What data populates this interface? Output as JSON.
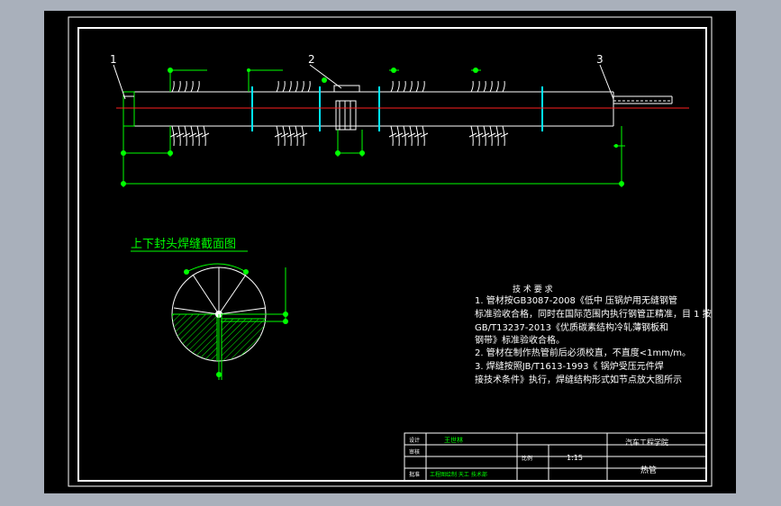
{
  "callouts": {
    "c1": "1",
    "c2": "2",
    "c3": "3"
  },
  "section_title": "上下封头焊缝截面图",
  "tech_req": {
    "title": "技 术 要 求",
    "lines": [
      "1. 管材按GB3087-2008《低中 压锅炉用无缝钢管",
      "标准验收合格，同时在国际范围内执行钢管正精准，目 1 按",
      "GB/T13237-2013《优质碳素结构冷轧薄钢板和",
      "钢带》标准验收合格。",
      "2. 管材在制作热管前后必须校直，不直度<1mm/m。",
      "3. 焊缝按照JB/T1613-1993《 锅炉受压元件焊",
      "接技术条件》执行，焊缝结构形式如节点放大图所示"
    ]
  },
  "title_block": {
    "company": "汽车工程学院",
    "scale_label": "比例",
    "scale": "1:15",
    "drawing_name": "热管",
    "rows": [
      "设计",
      "审核",
      "批准"
    ],
    "designer": "王世林",
    "row3_text": "工程图绘制 天工 技术部"
  },
  "colors": {
    "background": "#000000",
    "frame": "#ffffff",
    "dimension": "#00ff00",
    "centerline": "#ff2020",
    "screen": "#a9b0bb"
  }
}
